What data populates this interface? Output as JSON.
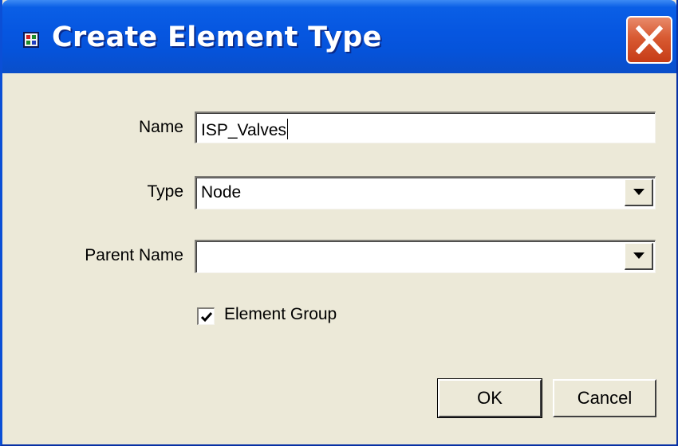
{
  "window": {
    "title": "Create Element Type",
    "icon": "app-icon",
    "close_icon": "close-icon"
  },
  "form": {
    "name_label": "Name",
    "name_value": "ISP_Valves",
    "type_label": "Type",
    "type_value": "Node",
    "parent_label": "Parent Name",
    "parent_value": "",
    "element_group_label": "Element Group",
    "element_group_checked": true
  },
  "buttons": {
    "ok_label": "OK",
    "cancel_label": "Cancel"
  },
  "colors": {
    "titlebar": "#0656e0",
    "dialog_bg": "#ece9d8",
    "close_button": "#d85a32"
  }
}
